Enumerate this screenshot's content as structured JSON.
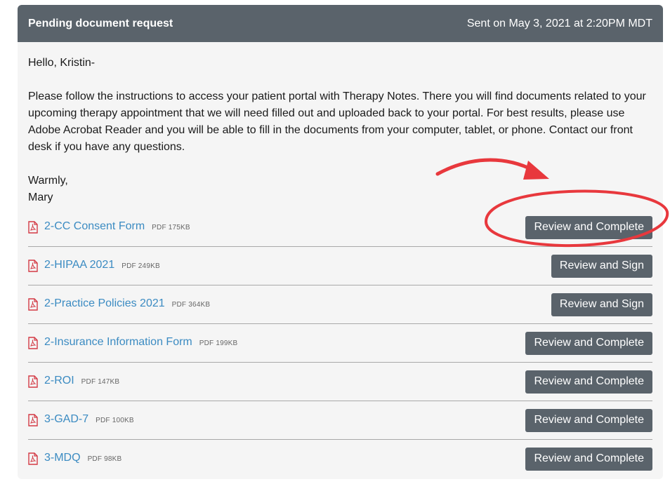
{
  "header": {
    "title": "Pending document request",
    "sent": "Sent on May 3, 2021 at 2:20PM MDT"
  },
  "message": {
    "greeting": "Hello, Kristin-",
    "body": "Please follow the instructions to access your patient portal with Therapy Notes. There you will find documents related to your upcoming therapy appointment that we will need filled out and uploaded back to your portal. For best results, please use Adobe Acrobat Reader and you will be able to fill in the documents from your computer, tablet, or phone. Contact our front desk if you have any questions.",
    "closing": "Warmly,",
    "signature": "Mary"
  },
  "documents": [
    {
      "name": "2-CC Consent Form",
      "meta": "PDF 175KB",
      "action": "Review and Complete"
    },
    {
      "name": "2-HIPAA 2021",
      "meta": "PDF 249KB",
      "action": "Review and Sign"
    },
    {
      "name": "2-Practice Policies 2021",
      "meta": "PDF 364KB",
      "action": "Review and Sign"
    },
    {
      "name": "2-Insurance Information Form",
      "meta": "PDF 199KB",
      "action": "Review and Complete"
    },
    {
      "name": "2-ROI",
      "meta": "PDF 147KB",
      "action": "Review and Complete"
    },
    {
      "name": "3-GAD-7",
      "meta": "PDF 100KB",
      "action": "Review and Complete"
    },
    {
      "name": "3-MDQ",
      "meta": "PDF 98KB",
      "action": "Review and Complete"
    }
  ],
  "icons": {
    "document": "pdf-file-icon"
  },
  "colors": {
    "header_bg": "#5a636b",
    "link": "#3b8bc2",
    "pdf_icon": "#d33a45",
    "annotation": "#e8383d"
  }
}
